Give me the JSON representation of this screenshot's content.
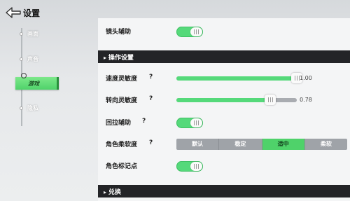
{
  "header": {
    "title": "设置",
    "back_icon": "back-arrow-icon"
  },
  "sidebar": {
    "items": [
      {
        "label": "画面"
      },
      {
        "label": "声音"
      },
      {
        "label": "游戏",
        "active": true
      },
      {
        "label": "隐私"
      }
    ]
  },
  "settings": {
    "camera_assist": {
      "label": "镜头辅助",
      "on": true
    },
    "section_controls": "操作设置",
    "speed_sensitivity": {
      "label": "速度灵敏度",
      "help": "?",
      "value": "1.00",
      "fraction": 1.0
    },
    "turn_sensitivity": {
      "label": "转向灵敏度",
      "help": "?",
      "value": "0.78",
      "fraction": 0.78
    },
    "pullback_assist": {
      "label": "回拉辅助",
      "help": "?",
      "on": true
    },
    "softness": {
      "label": "角色柔软度",
      "help": "?",
      "options": [
        "默认",
        "稳定",
        "适中",
        "柔软"
      ],
      "selected": "适中"
    },
    "marker": {
      "label": "角色标记点",
      "on": true
    },
    "section_exchange": "兑换"
  },
  "colors": {
    "accent": "#55d97a",
    "header_bg": "#232427"
  }
}
